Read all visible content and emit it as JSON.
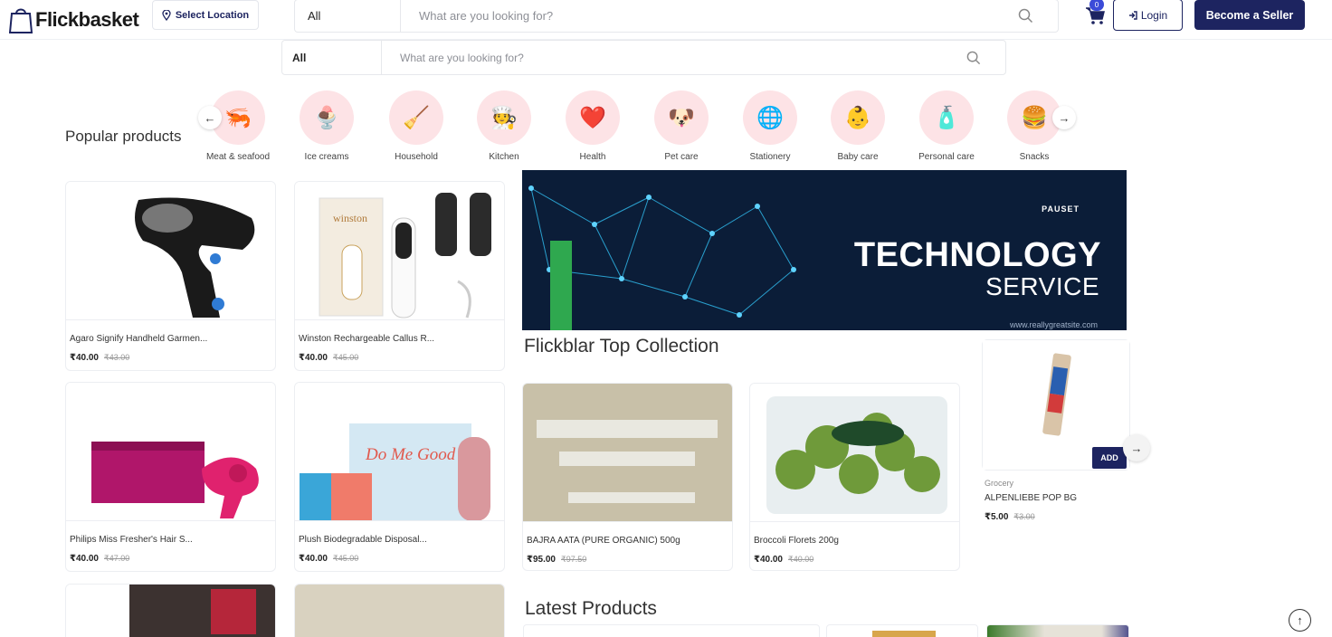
{
  "header": {
    "logo_text": "Flickbasket",
    "location_label": "Select Location",
    "search": {
      "category": "All",
      "placeholder": "What are you looking for?"
    },
    "cart_count": "0",
    "login_label": "Login",
    "seller_label": "Become a Seller"
  },
  "secondary_search": {
    "category": "All",
    "placeholder": "What are you looking for?"
  },
  "popular": {
    "title": "Popular products",
    "categories": [
      {
        "label": "Meat & seafood",
        "icon": "meat-icon"
      },
      {
        "label": "Ice creams",
        "icon": "ice-cream-icon"
      },
      {
        "label": "Household",
        "icon": "household-icon"
      },
      {
        "label": "Kitchen",
        "icon": "kitchen-icon"
      },
      {
        "label": "Health",
        "icon": "health-icon"
      },
      {
        "label": "Pet care",
        "icon": "pet-care-icon"
      },
      {
        "label": "Stationery",
        "icon": "stationery-icon"
      },
      {
        "label": "Baby care",
        "icon": "baby-care-icon"
      },
      {
        "label": "Personal care",
        "icon": "personal-care-icon"
      },
      {
        "label": "Snacks",
        "icon": "snacks-icon"
      }
    ]
  },
  "products": [
    {
      "name": "Agaro Signify Handheld Garmen...",
      "price": "₹40.00",
      "old_price": "₹43.00"
    },
    {
      "name": "Winston Rechargeable Callus R...",
      "price": "₹40.00",
      "old_price": "₹45.00"
    },
    {
      "name": "Philips Miss Fresher's Hair S...",
      "price": "₹40.00",
      "old_price": "₹47.00"
    },
    {
      "name": "Plush Biodegradable Disposal...",
      "price": "₹40.00",
      "old_price": "₹45.00"
    }
  ],
  "banner": {
    "brand": "PAUSET",
    "title": "TECHNOLOGY",
    "subtitle": "SERVICE",
    "url": "www.reallygreatsite.com"
  },
  "top_collection": {
    "title": "Flickblar Top Collection",
    "items": [
      {
        "name": "BAJRA AATA (PURE ORGANIC) 500g",
        "price": "₹95.00",
        "old_price": "₹97.50"
      },
      {
        "name": "Broccoli Florets 200g",
        "price": "₹40.00",
        "old_price": "₹40.00"
      }
    ],
    "featured": {
      "category": "Grocery",
      "name": "ALPENLIEBE POP BG",
      "price": "₹5.00",
      "old_price": "₹3.00",
      "add_label": "ADD"
    }
  },
  "latest": {
    "title": "Latest Products"
  },
  "colors": {
    "brand_navy": "#1d2460",
    "category_bg": "#fde3e6",
    "badge": "#3b4bd8"
  }
}
